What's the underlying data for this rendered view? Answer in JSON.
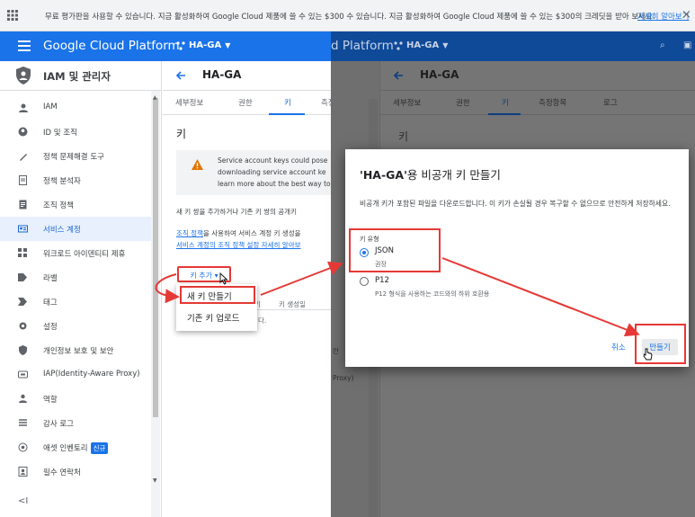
{
  "notice": {
    "text": "무료 평가판을 사용할 수 있습니다. 지금 활성화하여 Google Cloud 제품에 쓸 수 있는 $300 수 있습니다. 지금 활성화하여 Google Cloud 제품에 쓸 수 있는 $300의 크레딧을 받아 보세요.",
    "link": "자세히 알아보기",
    "close": "×"
  },
  "appbar": {
    "brand": "Google Cloud Platform",
    "brand_right": "d Platform",
    "project": "HA-GA"
  },
  "sidebar": {
    "title": "IAM 및 관리자",
    "items": [
      {
        "label": "IAM",
        "icon": "person-add-icon"
      },
      {
        "label": "ID 및 조직",
        "icon": "account-circle-icon"
      },
      {
        "label": "정책 문제해결 도구",
        "icon": "wrench-icon"
      },
      {
        "label": "정책 분석자",
        "icon": "policy-doc-icon"
      },
      {
        "label": "조직 정책",
        "icon": "list-doc-icon"
      },
      {
        "label": "서비스 계정",
        "icon": "service-account-icon",
        "active": true
      },
      {
        "label": "워크로드 아이덴티티 제휴",
        "icon": "grid-icon"
      },
      {
        "label": "라벨",
        "icon": "tag-icon"
      },
      {
        "label": "태그",
        "icon": "chevron-tag-icon"
      },
      {
        "label": "설정",
        "icon": "gear-icon"
      },
      {
        "label": "개인정보 보호 및 보안",
        "icon": "shield-icon"
      },
      {
        "label": "IAP(Identity-Aware Proxy)",
        "icon": "iap-icon"
      },
      {
        "label": "역할",
        "icon": "roles-icon"
      },
      {
        "label": "감사 로그",
        "icon": "log-icon"
      },
      {
        "label": "애셋 인벤토리",
        "icon": "inventory-icon",
        "badge": "신규"
      },
      {
        "label": "필수 연락처",
        "icon": "contacts-icon"
      }
    ],
    "collapse": "<I"
  },
  "main": {
    "title": "HA-GA",
    "tabs": [
      "세부정보",
      "권한",
      "키",
      "측정항목",
      "로그"
    ],
    "section": "키",
    "warning_lines": [
      "Service account keys could pose",
      "downloading service account ke",
      "learn more about the best way to"
    ],
    "para1": "새 키 쌍을 추가하거나 기존 키 쌍의 공개키",
    "para2_link": "조직 정책",
    "para2_rest": "을 사용하여 서비스 계정 키 생성을",
    "para3_link": "서비스 계정의 조직 정책 설정 자세히 알아보",
    "add_key": "키 추가 ▾",
    "menu": {
      "create_new": "새 키 만들기",
      "upload": "기존 키 업로드"
    },
    "table_col_1": "키",
    "table_col_2": "키 생성일",
    "table_frag": "다."
  },
  "right_bg": {
    "section": "키",
    "frag1": "안",
    "frag2": "Proxy)"
  },
  "dialog": {
    "title_quote": "'HA-GA'",
    "title_rest": "용 비공개 키 만들기",
    "desc": "비공개 키가 포함된 파일을 다운로드합니다. 이 키가 손실될 경우 복구할 수 없으므로 안전하게 저장하세요.",
    "key_type_label": "키 유형",
    "options": [
      {
        "label": "JSON",
        "sub": "권장",
        "selected": true
      },
      {
        "label": "P12",
        "sub": "P12 형식을 사용하는 코드와의 하위 호환용",
        "selected": false
      }
    ],
    "cancel": "취소",
    "create": "만들기"
  },
  "colors": {
    "accent": "#1a73e8",
    "highlight": "#e53935",
    "overlay": "#757575"
  }
}
